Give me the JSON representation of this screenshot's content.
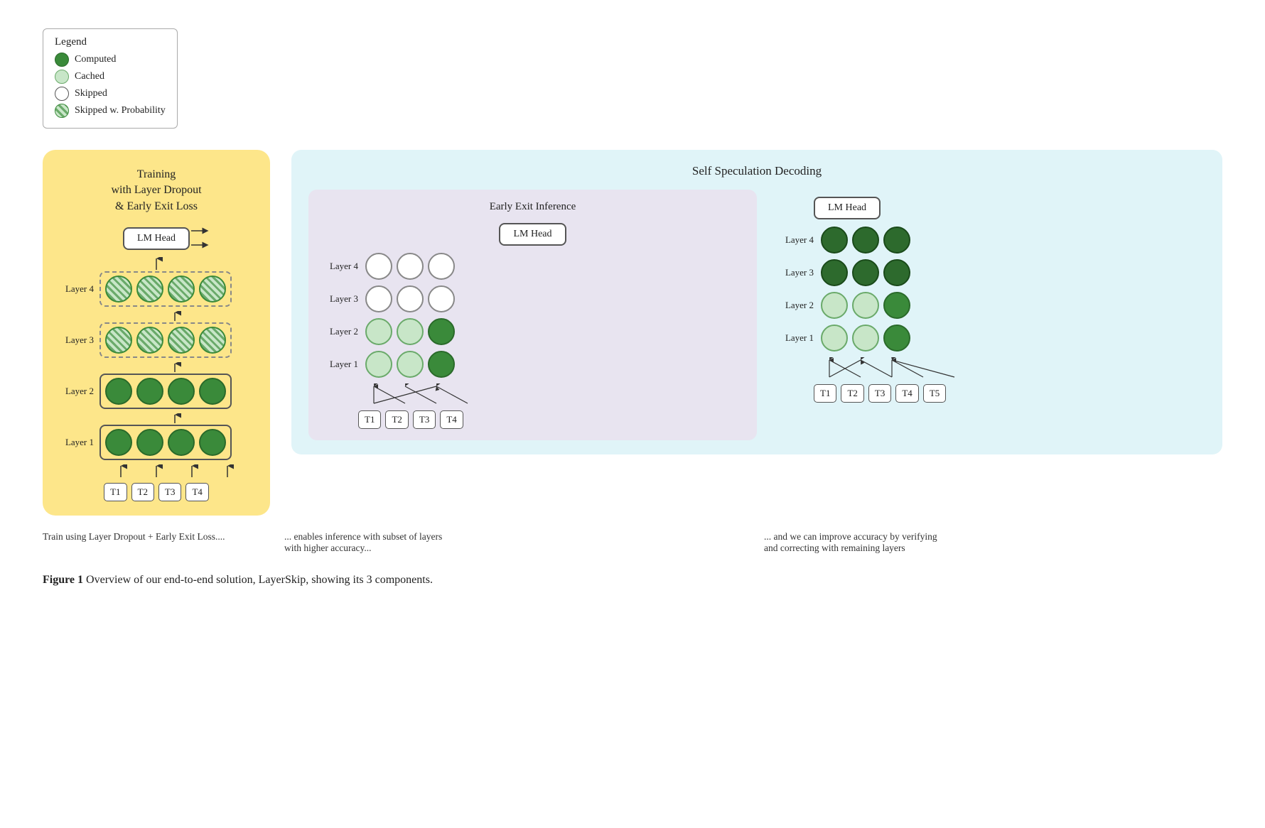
{
  "legend": {
    "title": "Legend",
    "items": [
      {
        "label": "Computed",
        "type": "computed"
      },
      {
        "label": "Cached",
        "type": "cached"
      },
      {
        "label": "Skipped",
        "type": "skipped"
      },
      {
        "label": "Skipped w. Probability",
        "type": "skipped-prob"
      }
    ]
  },
  "training": {
    "title": "Training\nwith Layer Dropout\n& Early Exit Loss",
    "title_line1": "Training",
    "title_line2": "with Layer Dropout",
    "title_line3": "& Early Exit Loss",
    "lm_head": "LM Head",
    "layers": [
      {
        "label": "Layer 4",
        "node_type": "skipped-prob"
      },
      {
        "label": "Layer 3",
        "node_type": "skipped-prob"
      },
      {
        "label": "Layer 2",
        "node_type": "computed"
      },
      {
        "label": "Layer 1",
        "node_type": "computed"
      }
    ],
    "tokens": [
      "T1",
      "T2",
      "T3",
      "T4"
    ]
  },
  "self_spec": {
    "title": "Self Speculation Decoding",
    "early_exit": {
      "title": "Early Exit Inference",
      "lm_head": "LM Head",
      "layers": [
        {
          "label": "Layer 4",
          "node_types": [
            "skipped",
            "skipped",
            "skipped"
          ]
        },
        {
          "label": "Layer 3",
          "node_types": [
            "skipped",
            "skipped",
            "skipped"
          ]
        },
        {
          "label": "Layer 2",
          "node_types": [
            "cached",
            "cached",
            "computed"
          ]
        },
        {
          "label": "Layer 1",
          "node_types": [
            "cached",
            "cached",
            "computed"
          ]
        }
      ],
      "tokens": [
        "T1",
        "T2",
        "T3",
        "T4"
      ]
    },
    "verification": {
      "lm_head": "LM Head",
      "layers": [
        {
          "label": "Layer 4",
          "node_types": [
            "dark",
            "dark",
            "dark"
          ]
        },
        {
          "label": "Layer 3",
          "node_types": [
            "dark",
            "dark",
            "dark"
          ]
        },
        {
          "label": "Layer 2",
          "node_types": [
            "cached",
            "cached",
            "computed"
          ]
        },
        {
          "label": "Layer 1",
          "node_types": [
            "cached",
            "cached",
            "computed"
          ]
        }
      ],
      "tokens": [
        "T1",
        "T2",
        "T3",
        "T4",
        "T5"
      ]
    }
  },
  "captions": {
    "training": "Train using Layer Dropout + Early Exit Loss....",
    "early_exit": "... enables inference with subset of layers\nwith higher accuracy...",
    "verification": "... and we can improve accuracy by verifying\nand correcting with remaining layers"
  },
  "figure_caption": {
    "label": "Figure 1",
    "text": " Overview of our end-to-end solution, LayerSkip, showing its 3 components."
  }
}
